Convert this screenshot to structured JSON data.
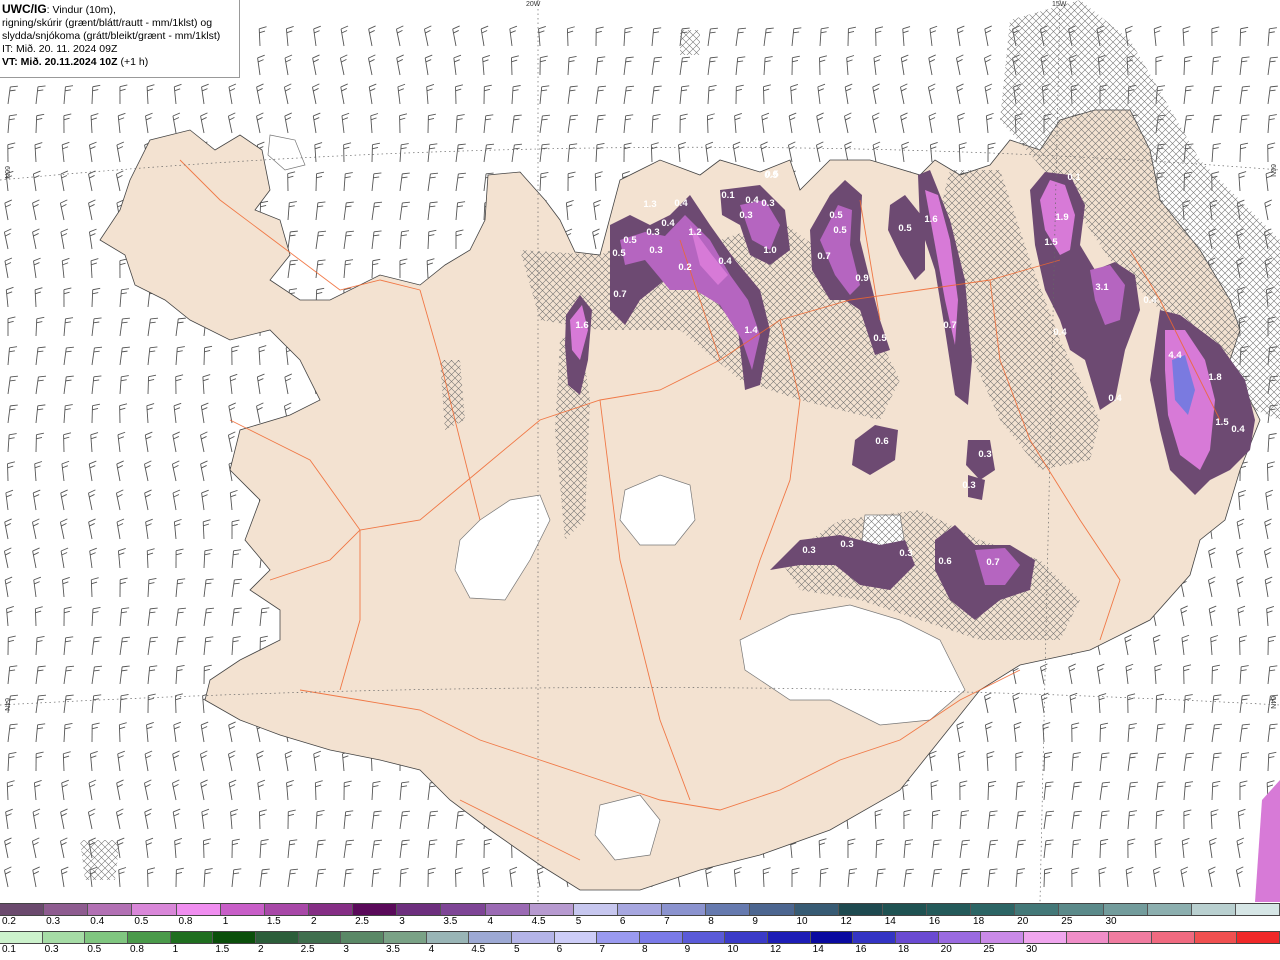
{
  "header": {
    "model_code": "UWC/IG",
    "title_rest": ": Vindur (10m),",
    "line2": "rigning/skúrir (grænt/blátt/rautt - mm/1klst) og",
    "line3": "slydda/snjókoma (grátt/bleikt/grænt - mm/1klst)",
    "it_line": "IT: Mið. 20. 11. 2024 09Z",
    "vt_prefix": "VT: Mið. 20.11.2024 10Z",
    "vt_suffix": " (+1 h)"
  },
  "grid_labels": {
    "lon_20w": "20W",
    "lon_15w": "15W",
    "lat_66n_left": "66N",
    "lat_66n_right": "66N",
    "lat_64n_left": "64N",
    "lat_64n_right": "64N"
  },
  "precip_labels": [
    {
      "t": "1.3"
    },
    {
      "t": "0.4"
    },
    {
      "t": "0.5"
    },
    {
      "t": "0.3"
    },
    {
      "t": "0.4"
    },
    {
      "t": "0.5"
    },
    {
      "t": "0.3"
    },
    {
      "t": "1.2"
    },
    {
      "t": "0.7"
    },
    {
      "t": "0.2"
    },
    {
      "t": "0.1"
    },
    {
      "t": "0.3"
    },
    {
      "t": "0.4"
    },
    {
      "t": "0.5"
    },
    {
      "t": "0.3"
    },
    {
      "t": "0.5"
    },
    {
      "t": "1.0"
    },
    {
      "t": "1.4"
    },
    {
      "t": "0.4"
    },
    {
      "t": "0.5"
    },
    {
      "t": "0.5"
    },
    {
      "t": "0.7"
    },
    {
      "t": "0.9"
    },
    {
      "t": "0.5"
    },
    {
      "t": "0.5"
    },
    {
      "t": "1.6"
    },
    {
      "t": "0.7"
    },
    {
      "t": "0.1"
    },
    {
      "t": "1.9"
    },
    {
      "t": "1.5"
    },
    {
      "t": "3.1"
    },
    {
      "t": "0.4"
    },
    {
      "t": "0.4"
    },
    {
      "t": "4.4"
    },
    {
      "t": "1.8"
    },
    {
      "t": "0.4"
    },
    {
      "t": "1.5"
    },
    {
      "t": "0.4"
    },
    {
      "t": "0.6"
    },
    {
      "t": "0.3"
    },
    {
      "t": "0.3"
    },
    {
      "t": "0.3"
    },
    {
      "t": "0.3"
    },
    {
      "t": "0.6"
    },
    {
      "t": "0.3"
    },
    {
      "t": "0.7"
    },
    {
      "t": "1.6"
    }
  ],
  "legend_snow": {
    "colors": [
      "#6b4a6e",
      "#8e5c90",
      "#b270b4",
      "#d987d9",
      "#f08ef0",
      "#c85ec8",
      "#a848a8",
      "#852e85",
      "#5a0a5a",
      "#6d2f7e",
      "#7e4596",
      "#9b6ab4",
      "#b79ad0",
      "#c7c7ef",
      "#a7a7e0",
      "#8b93cf",
      "#667aaf",
      "#4c6690",
      "#375b74",
      "#1e4a50",
      "#1f5252",
      "#245a5a",
      "#2c6565",
      "#437878",
      "#5b8a8a",
      "#739c9c",
      "#8cafaf",
      "#b9d0d0",
      "#d6e6e6"
    ],
    "ticks": [
      "0.2",
      "0.3",
      "0.4",
      "0.5",
      "0.8",
      "1",
      "1.5",
      "2",
      "2.5",
      "3",
      "3.5",
      "4",
      "4.5",
      "5",
      "6",
      "7",
      "8",
      "9",
      "10",
      "12",
      "14",
      "16",
      "18",
      "20",
      "25",
      "30"
    ]
  },
  "legend_rain": {
    "colors": [
      "#ccf2cc",
      "#a6dca6",
      "#80c680",
      "#4a9a4a",
      "#1f6e1f",
      "#0b4f0b",
      "#2c5e3a",
      "#406f4e",
      "#5a8866",
      "#7aa286",
      "#99b5b6",
      "#9da9d4",
      "#b4b4e8",
      "#cdcdf8",
      "#9a9af0",
      "#7a7ae8",
      "#5a5ad8",
      "#3b3bc8",
      "#1d1db6",
      "#0a0aa0",
      "#3434c4",
      "#6a4ad2",
      "#9a6ae0",
      "#ca8ae8",
      "#f0a6ee",
      "#f08ec8",
      "#f07ca0",
      "#f06a80",
      "#f05050",
      "#f02828"
    ],
    "ticks": [
      "0.1",
      "0.3",
      "0.5",
      "0.8",
      "1",
      "1.5",
      "2",
      "2.5",
      "3",
      "3.5",
      "4",
      "4.5",
      "5",
      "6",
      "7",
      "8",
      "9",
      "10",
      "12",
      "14",
      "16",
      "18",
      "20",
      "25",
      "30"
    ]
  }
}
